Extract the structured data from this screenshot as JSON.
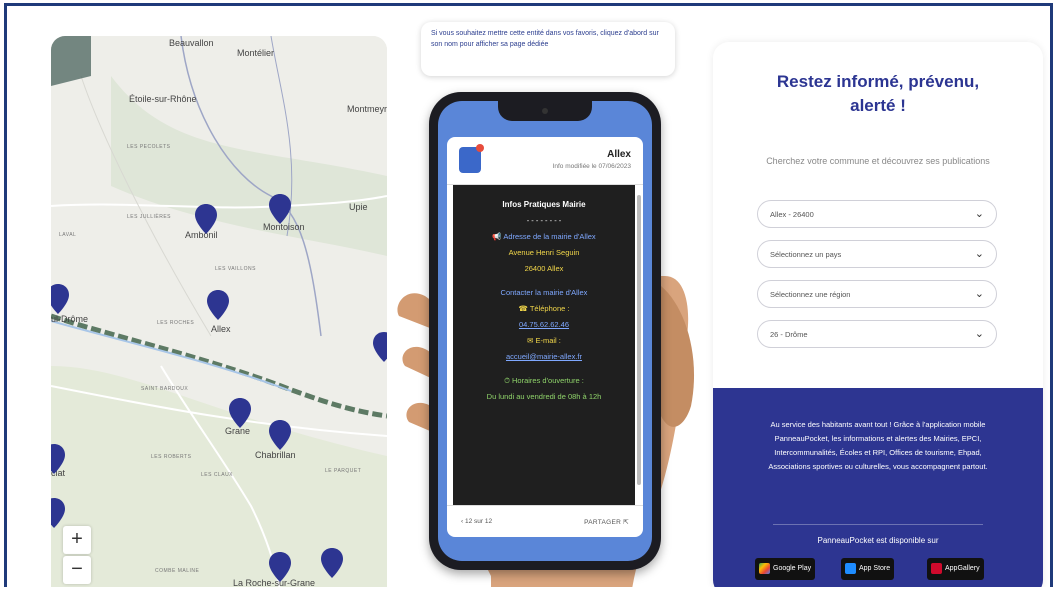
{
  "map": {
    "places": {
      "beauvallon": "Beauvallon",
      "montelegier": "Montélier",
      "etoile": "Étoile-sur-Rhône",
      "montmeyran": "Montmeyra",
      "upie": "Upie",
      "ambonil": "Ambonil",
      "montoison": "Montoison",
      "allex": "Allex",
      "drome": "ul-Drôme",
      "grane": "Grane",
      "chabrillan": "Chabrillan",
      "roche": "La Roche-sur-Grane",
      "clat": "clat"
    },
    "localities": {
      "pecolets": "LES PECOLETS",
      "jullieres": "LES JULLIÈRES",
      "laval": "LAVAL",
      "vaillons": "LES VAILLONS",
      "roches": "LES ROCHES",
      "bardoux": "SAINT BARDOUX",
      "robert": "LES ROBERTS",
      "claux": "LES CLAUX",
      "parquet": "LE PARQUET",
      "combe": "COMBE MALINE"
    },
    "zoom_in": "+",
    "zoom_out": "−"
  },
  "hint": {
    "text": "Si vous souhaitez mettre cette entité dans vos favoris, cliquez d'abord sur son nom pour afficher sa page dédiée"
  },
  "phone": {
    "title": "Allex",
    "subtitle": "Info modifiée le 07/06/2023",
    "heading": "Infos Pratiques Mairie",
    "dashes": "- - - - - - - -",
    "address_label": "Adresse de la mairie d'Allex",
    "address_line1": "Avenue Henri Seguin",
    "address_line2": "26400 Allex",
    "contact_label": "Contacter la mairie d'Allex",
    "phone_label": "☎ Téléphone :",
    "phone_value": "04.75.62.62.46",
    "email_label": "✉ E-mail :",
    "email_value": "accueil@mairie-allex.fr",
    "hours_label": "⏱ Horaires d'ouverture :",
    "hours_value": "Du lundi au vendredi de 08h à 12h",
    "pager": "12 sur 12",
    "share": "PARTAGER"
  },
  "panel": {
    "title_line1": "Restez informé, prévenu,",
    "title_line2": "alerté !",
    "lead": "Cherchez votre commune et découvrez ses publications",
    "selects": [
      "Allex - 26400",
      "Sélectionnez un pays",
      "Sélectionnez une région",
      "26 - Drôme"
    ],
    "service": "Au service des habitants avant tout ! Grâce à l'application mobile PanneauPocket, les informations et alertes des Mairies, EPCI, Intercommunalités, Écoles et RPI, Offices de tourisme, Ehpad, Associations sportives ou culturelles, vous accompagnent partout.",
    "available": "PanneauPocket est disponible sur",
    "stores": [
      "Google Play",
      "App Store",
      "AppGallery"
    ]
  },
  "colors": {
    "brand_blue": "#2d3591",
    "map_pin": "#2d3591"
  }
}
